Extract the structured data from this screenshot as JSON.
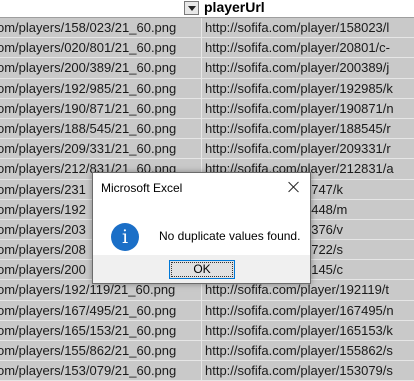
{
  "header": {
    "column_b_title": "playerUrl"
  },
  "rows": [
    {
      "a": "om/players/158/023/21_60.png",
      "b": "http://sofifa.com/player/158023/l"
    },
    {
      "a": "om/players/020/801/21_60.png",
      "b": "http://sofifa.com/player/20801/c-"
    },
    {
      "a": "om/players/200/389/21_60.png",
      "b": "http://sofifa.com/player/200389/j"
    },
    {
      "a": "om/players/192/985/21_60.png",
      "b": "http://sofifa.com/player/192985/k"
    },
    {
      "a": "om/players/190/871/21_60.png",
      "b": "http://sofifa.com/player/190871/n"
    },
    {
      "a": "om/players/188/545/21_60.png",
      "b": "http://sofifa.com/player/188545/r"
    },
    {
      "a": "om/players/209/331/21_60.png",
      "b": "http://sofifa.com/player/209331/r"
    },
    {
      "a": "om/players/212/831/21_60.png",
      "b": "http://sofifa.com/player/212831/a"
    },
    {
      "a": "om/players/231",
      "b": "ifa.com/player/231747/k"
    },
    {
      "a": "om/players/192",
      "b": "ifa.com/player/192448/m"
    },
    {
      "a": "om/players/203",
      "b": "ifa.com/player/203376/v"
    },
    {
      "a": "om/players/208",
      "b": "ifa.com/player/208722/s"
    },
    {
      "a": "om/players/200",
      "b": "ifa.com/player/200145/c"
    },
    {
      "a": "om/players/192/119/21_60.png",
      "b": "http://sofifa.com/player/192119/t"
    },
    {
      "a": "om/players/167/495/21_60.png",
      "b": "http://sofifa.com/player/167495/n"
    },
    {
      "a": "om/players/165/153/21_60.png",
      "b": "http://sofifa.com/player/165153/k"
    },
    {
      "a": "om/players/155/862/21_60.png",
      "b": "http://sofifa.com/player/155862/s"
    },
    {
      "a": "om/players/153/079/21_60.png",
      "b": "http://sofifa.com/player/153079/s"
    }
  ],
  "dialog": {
    "title": "Microsoft Excel",
    "message": "No duplicate values found.",
    "ok_label": "OK",
    "icon": "info-icon",
    "icon_glyph": "i"
  },
  "colors": {
    "selection_fill": "#c9c9c9",
    "info_blue": "#1b6fc7",
    "button_focus": "#0078d7"
  }
}
